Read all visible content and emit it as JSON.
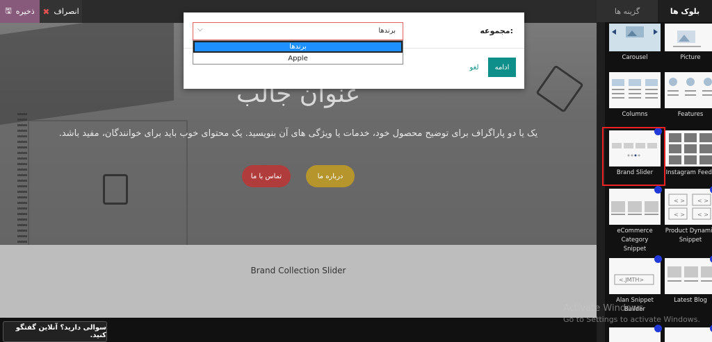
{
  "toolbar": {
    "save_label": "ذخیره",
    "cancel_label": "انصراف"
  },
  "hero": {
    "title": "عنوان جالب",
    "description": "یک یا دو پاراگراف برای توضیح محصول خود، خدمات یا ویژگی های آن بنویسید. یک محتوای خوب باید برای خوانندگان، مفید باشد.",
    "btn_contact": "تماس با ما",
    "btn_about": "درباره ما"
  },
  "section2": {
    "caption": "Brand Collection Slider"
  },
  "chat": {
    "label": "سوالی دارید؟ آنلاین گفتگو کنید."
  },
  "panel": {
    "tab_blocks": "بلوک ها",
    "tab_options": "گزینه ها",
    "tiles": [
      {
        "label": "Carousel"
      },
      {
        "label": "Picture"
      },
      {
        "label": "Columns"
      },
      {
        "label": "Features"
      },
      {
        "label": "Brand Slider"
      },
      {
        "label": "Instagram Feeds"
      },
      {
        "label": "eCommerce Category Snippet"
      },
      {
        "label": "Product Dynamic Snippet"
      },
      {
        "label": "Alan Snippet Builder"
      },
      {
        "label": "Latest Blog"
      }
    ]
  },
  "modal": {
    "field_label": "مجموعه:",
    "selected_value": "برندها",
    "options": [
      "برندها",
      "Apple"
    ],
    "continue_label": "ادامه",
    "discard_label": "لغو"
  },
  "watermark": {
    "line1": "Activate Windows",
    "line2": "Go to Settings to activate Windows."
  },
  "colors": {
    "accent": "#875a7b",
    "primary_teal": "#0f8f8a",
    "selection_blue": "#1e90ff"
  }
}
